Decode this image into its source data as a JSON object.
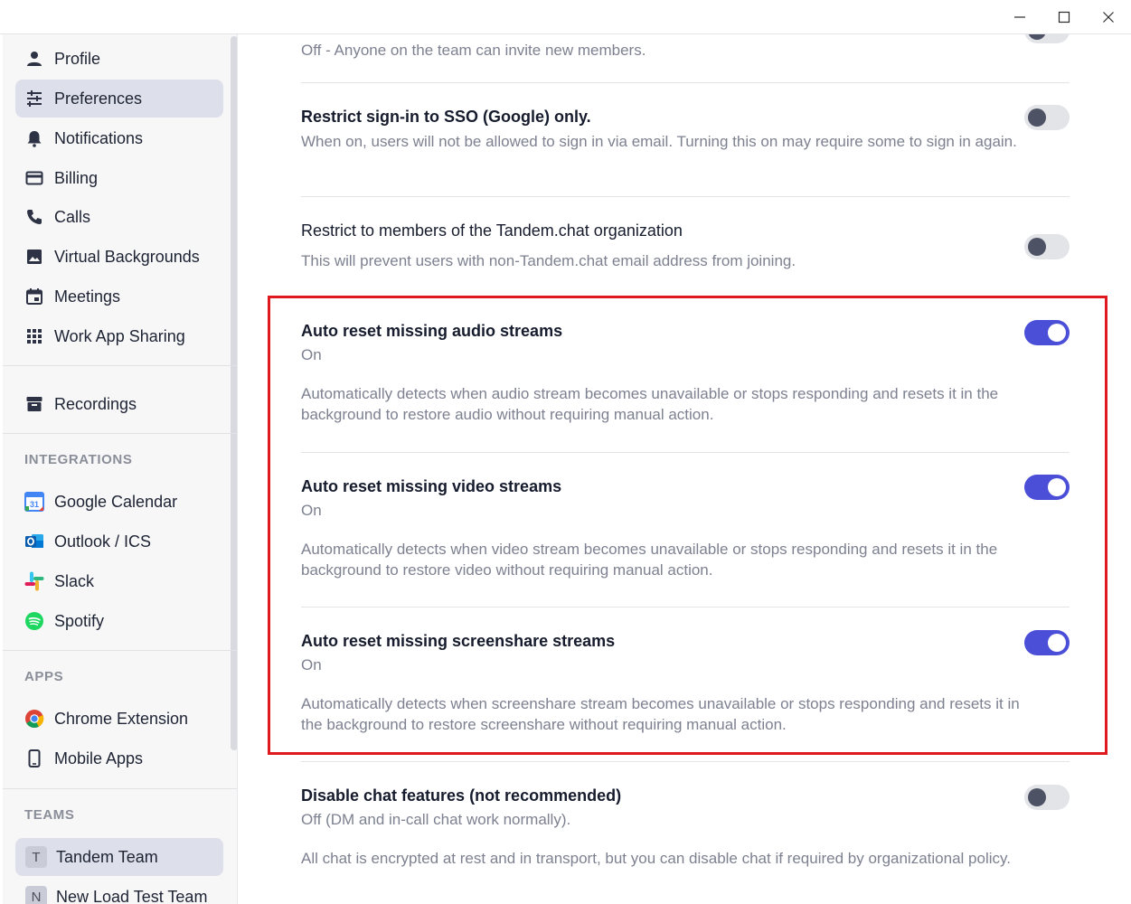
{
  "window": {
    "minimize_icon": "minimize-icon",
    "maximize_icon": "maximize-icon",
    "close_icon": "close-icon"
  },
  "sidebar": {
    "items": [
      {
        "label": "Profile",
        "icon": "person-icon"
      },
      {
        "label": "Preferences",
        "icon": "sliders-icon",
        "active": true
      },
      {
        "label": "Notifications",
        "icon": "bell-icon"
      },
      {
        "label": "Billing",
        "icon": "credit-card-icon"
      },
      {
        "label": "Calls",
        "icon": "phone-icon"
      },
      {
        "label": "Virtual Backgrounds",
        "icon": "image-icon"
      },
      {
        "label": "Meetings",
        "icon": "calendar-icon"
      },
      {
        "label": "Work App Sharing",
        "icon": "grid-icon"
      },
      {
        "label": "Recordings",
        "icon": "archive-icon"
      }
    ],
    "integrations_heading": "INTEGRATIONS",
    "integrations": [
      {
        "label": "Google Calendar",
        "icon": "google-calendar-icon"
      },
      {
        "label": "Outlook / ICS",
        "icon": "outlook-icon"
      },
      {
        "label": "Slack",
        "icon": "slack-icon"
      },
      {
        "label": "Spotify",
        "icon": "spotify-icon"
      }
    ],
    "apps_heading": "APPS",
    "apps": [
      {
        "label": "Chrome Extension",
        "icon": "chrome-icon"
      },
      {
        "label": "Mobile Apps",
        "icon": "mobile-phone-icon"
      }
    ],
    "teams_heading": "TEAMS",
    "teams": [
      {
        "initial": "T",
        "label": "Tandem Team",
        "active": true
      },
      {
        "initial": "N",
        "label": "New Load Test Team"
      }
    ]
  },
  "settings": {
    "invite": {
      "desc": "Off - Anyone on the team can invite new members."
    },
    "sso": {
      "title": "Restrict sign-in to SSO (Google) only.",
      "desc": "When on, users will not be allowed to sign in via email. Turning this on may require some to sign in again.",
      "enabled": false
    },
    "org_members": {
      "title": "Restrict to members of the Tandem.chat organization",
      "desc": "This will prevent users with non-Tandem.chat email address from joining.",
      "enabled": false
    },
    "audio": {
      "title": "Auto reset missing audio streams",
      "status": "On",
      "desc": "Automatically detects when audio stream becomes unavailable or stops responding and resets it in the background to restore audio without requiring manual action.",
      "enabled": true
    },
    "video": {
      "title": "Auto reset missing video streams",
      "status": "On",
      "desc": "Automatically detects when video stream becomes unavailable or stops responding and resets it in the background to restore video without requiring manual action.",
      "enabled": true
    },
    "screenshare": {
      "title": "Auto reset missing screenshare streams",
      "status": "On",
      "desc": "Automatically detects when screenshare stream becomes unavailable or stops responding and resets it in the background to restore screenshare without requiring manual action.",
      "enabled": true
    },
    "chat": {
      "title": "Disable chat features (not recommended)",
      "status": "Off (DM and in-call chat work normally).",
      "desc": "All chat is encrypted at rest and in transport, but you can disable chat if required by organizational policy.",
      "enabled": false
    }
  },
  "colors": {
    "accent": "#4b4fd8",
    "highlight_border": "#e0191e",
    "sidebar_active": "#dde0ea"
  }
}
